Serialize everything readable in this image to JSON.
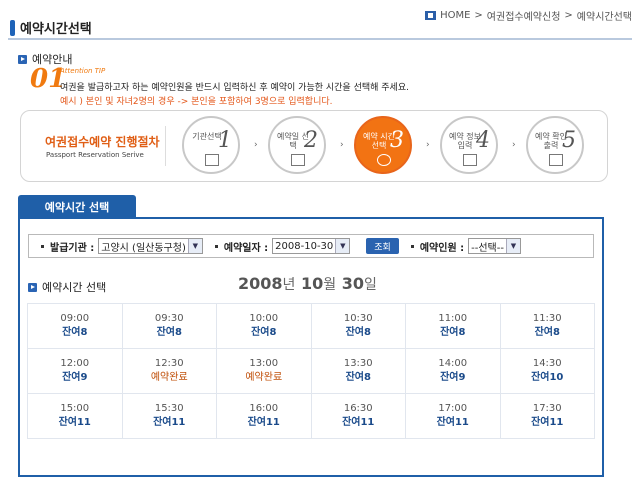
{
  "page": {
    "title": "예약시간선택",
    "breadcrumb": [
      "HOME",
      "여권접수예약신청",
      "예약시간선택"
    ]
  },
  "notice": {
    "heading": "예약안내",
    "tip_number": "01",
    "tip_label": "Attention TIP",
    "line1": "여권을 발급하고자 하는 예약인원을 반드시 입력하신 후 예약이 가능한 시간을 선택해 주세요.",
    "line2": "예시 ) 본인 및 자녀2명의 경우 -> 본인을 포함하여 3명으로 입력합니다."
  },
  "process": {
    "title": "여권접수예약 진행절차",
    "subtitle": "Passport Reservation Serive",
    "steps": [
      {
        "label": "기관선택",
        "num": "1",
        "icon": "building-icon",
        "active": false
      },
      {
        "label": "예약일 선택",
        "num": "2",
        "icon": "calendar-icon",
        "active": false
      },
      {
        "label": "예약 시간선택",
        "num": "3",
        "icon": "alarm-clock-icon",
        "active": true
      },
      {
        "label": "예약 정보입력",
        "num": "4",
        "icon": "pencil-icon",
        "active": false
      },
      {
        "label": "예약 확인출력",
        "num": "5",
        "icon": "monitor-icon",
        "active": false
      }
    ]
  },
  "tab": {
    "label": "예약시간 선택"
  },
  "filter": {
    "agency_label": "발급기관 :",
    "agency_value": "고양시 (일산동구청)",
    "date_label": "예약일자 :",
    "date_value": "2008-10-30",
    "search_button": "조회",
    "count_label": "예약인원 :",
    "count_value": "--선택--"
  },
  "schedule": {
    "heading": "예약시간 선택",
    "date_year": "2008",
    "date_year_unit": "년",
    "date_month": "10",
    "date_month_unit": "월",
    "date_day": "30",
    "date_day_unit": "일",
    "rows": [
      [
        {
          "time": "09:00",
          "status": "잔여8",
          "full": false
        },
        {
          "time": "09:30",
          "status": "잔여8",
          "full": false
        },
        {
          "time": "10:00",
          "status": "잔여8",
          "full": false
        },
        {
          "time": "10:30",
          "status": "잔여8",
          "full": false
        },
        {
          "time": "11:00",
          "status": "잔여8",
          "full": false
        },
        {
          "time": "11:30",
          "status": "잔여8",
          "full": false
        }
      ],
      [
        {
          "time": "12:00",
          "status": "잔여9",
          "full": false
        },
        {
          "time": "12:30",
          "status": "예약완료",
          "full": true
        },
        {
          "time": "13:00",
          "status": "예약완료",
          "full": true
        },
        {
          "time": "13:30",
          "status": "잔여8",
          "full": false
        },
        {
          "time": "14:00",
          "status": "잔여9",
          "full": false
        },
        {
          "time": "14:30",
          "status": "잔여10",
          "full": false
        }
      ],
      [
        {
          "time": "15:00",
          "status": "잔여11",
          "full": false
        },
        {
          "time": "15:30",
          "status": "잔여11",
          "full": false
        },
        {
          "time": "16:00",
          "status": "잔여11",
          "full": false
        },
        {
          "time": "16:30",
          "status": "잔여11",
          "full": false
        },
        {
          "time": "17:00",
          "status": "잔여11",
          "full": false
        },
        {
          "time": "17:30",
          "status": "잔여11",
          "full": false
        }
      ]
    ]
  },
  "colors": {
    "accent": "#1f5fa8",
    "orange": "#f27313"
  }
}
